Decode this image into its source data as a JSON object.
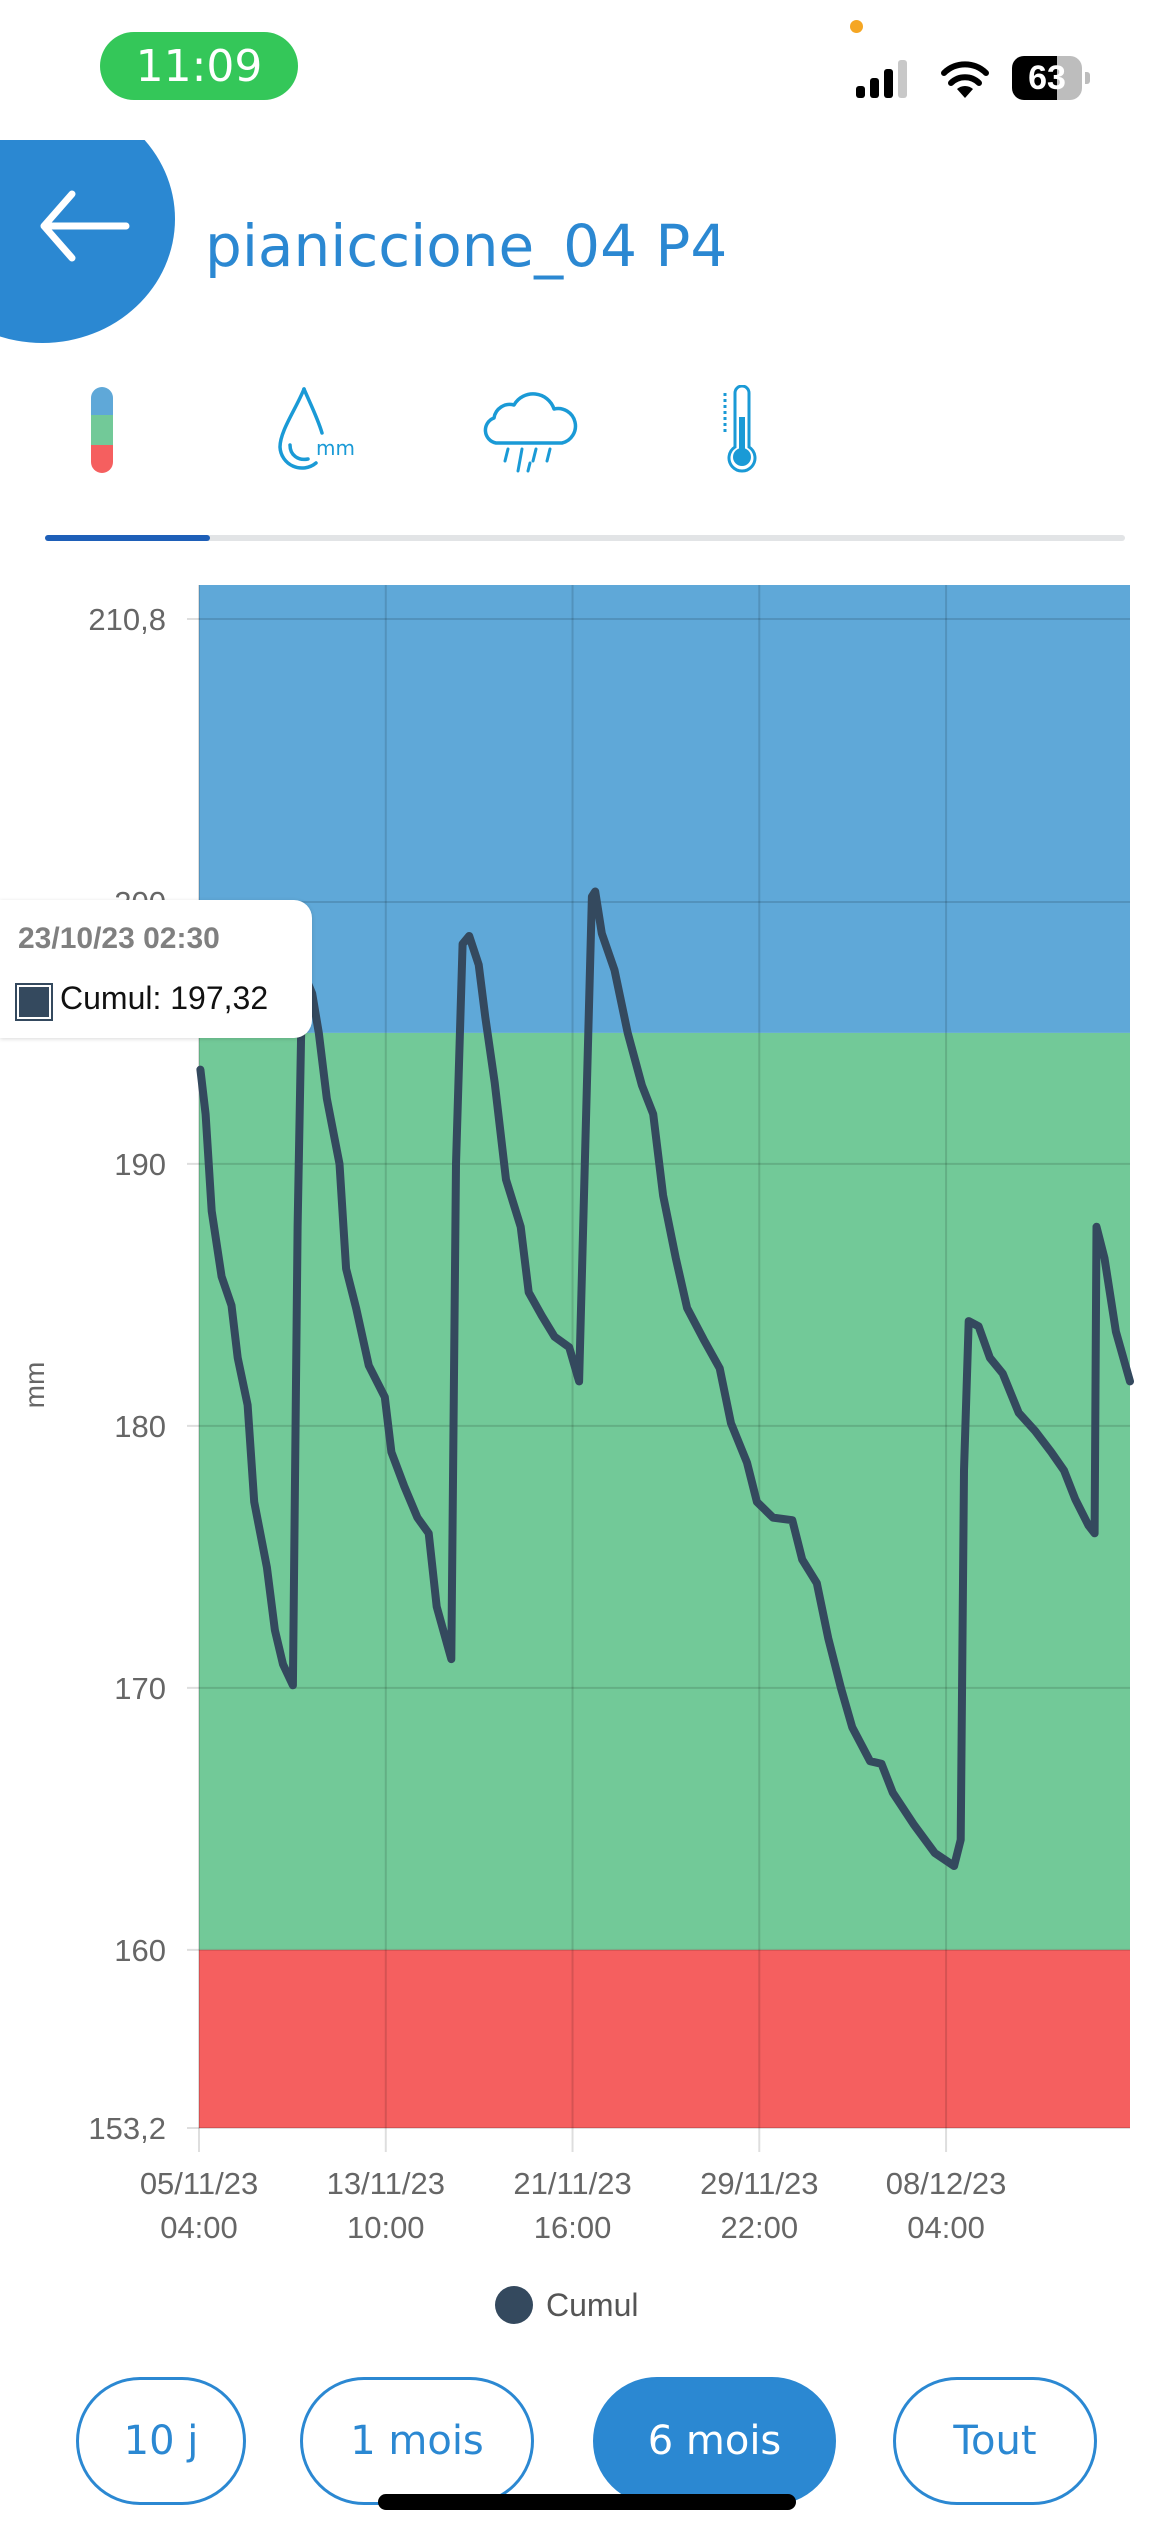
{
  "status_bar": {
    "time": "11:09",
    "battery": "63",
    "icons": [
      "cellular-signal-icon",
      "wifi-icon",
      "battery-icon"
    ]
  },
  "header": {
    "title": "pianiccione_04 P4",
    "back_icon": "arrow-left-icon"
  },
  "tabs": [
    {
      "icon": "threshold-gauge-icon",
      "active": true
    },
    {
      "icon": "water-drop-mm-icon",
      "active": false
    },
    {
      "icon": "rain-cloud-icon",
      "active": false
    },
    {
      "icon": "thermometer-icon",
      "active": false
    }
  ],
  "colors": {
    "accent": "#2b88d2",
    "band_high": "#5fa8d8",
    "band_mid": "#72c998",
    "band_low": "#f55f5f",
    "series": "#34495e"
  },
  "tooltip": {
    "date": "23/10/23 02:30",
    "text": "Cumul: 197,32"
  },
  "chart_data": {
    "type": "line",
    "title": "",
    "xlabel": "",
    "ylabel": "mm",
    "ylim": [
      153.2,
      210.8
    ],
    "xlim": [
      "2023-11-05T04:00",
      "2023-12-16T07:00"
    ],
    "y_ticks": [
      "210,8",
      "200",
      "190",
      "180",
      "170",
      "160",
      "153,2"
    ],
    "y_tick_values": [
      210.8,
      200,
      190,
      180,
      170,
      160,
      153.2
    ],
    "x_ticks": [
      {
        "value": "2023-11-05T04:00",
        "line1": "05/11/23",
        "line2": "04:00"
      },
      {
        "value": "2023-11-13T10:00",
        "line1": "13/11/23",
        "line2": "10:00"
      },
      {
        "value": "2023-11-21T16:00",
        "line1": "21/11/23",
        "line2": "16:00"
      },
      {
        "value": "2023-11-29T22:00",
        "line1": "29/11/23",
        "line2": "22:00"
      },
      {
        "value": "2023-12-08T04:00",
        "line1": "08/12/23",
        "line2": "04:00"
      }
    ],
    "grid": true,
    "bands": [
      {
        "from": 195,
        "to": 210.8,
        "color": "#5fa8d8"
      },
      {
        "from": 160,
        "to": 195,
        "color": "#72c998"
      },
      {
        "from": 153.2,
        "to": 160,
        "color": "#f55f5f"
      }
    ],
    "legend": {
      "position": "bottom",
      "entries": [
        "Cumul"
      ]
    },
    "series": [
      {
        "name": "Cumul",
        "color": "#34495e",
        "points": [
          [
            "2023-11-05T05:30",
            193.6
          ],
          [
            "2023-11-05T11:00",
            191.9
          ],
          [
            "2023-11-05T17:30",
            188.2
          ],
          [
            "2023-11-06T04:00",
            185.7
          ],
          [
            "2023-11-06T14:30",
            184.6
          ],
          [
            "2023-11-06T21:00",
            182.6
          ],
          [
            "2023-11-07T07:30",
            180.8
          ],
          [
            "2023-11-07T14:30",
            177.1
          ],
          [
            "2023-11-08T04:00",
            174.6
          ],
          [
            "2023-11-08T12:30",
            172.2
          ],
          [
            "2023-11-08T21:00",
            170.9
          ],
          [
            "2023-11-09T07:30",
            170.1
          ],
          [
            "2023-11-09T12:30",
            187.6
          ],
          [
            "2023-11-09T17:30",
            197.4
          ],
          [
            "2023-11-10T04:00",
            196.5
          ],
          [
            "2023-11-10T11:00",
            195.0
          ],
          [
            "2023-11-10T19:30",
            192.5
          ],
          [
            "2023-11-11T09:00",
            190.0
          ],
          [
            "2023-11-11T16:00",
            186.0
          ],
          [
            "2023-11-12T02:30",
            184.5
          ],
          [
            "2023-11-12T16:00",
            182.3
          ],
          [
            "2023-11-13T09:00",
            181.1
          ],
          [
            "2023-11-13T16:00",
            179.0
          ],
          [
            "2023-11-14T05:30",
            177.7
          ],
          [
            "2023-11-14T19:30",
            176.5
          ],
          [
            "2023-11-15T07:30",
            175.9
          ],
          [
            "2023-11-15T16:00",
            173.1
          ],
          [
            "2023-11-16T07:30",
            171.1
          ],
          [
            "2023-11-16T12:30",
            190.0
          ],
          [
            "2023-11-16T19:30",
            198.4
          ],
          [
            "2023-11-17T02:30",
            198.7
          ],
          [
            "2023-11-17T12:30",
            197.6
          ],
          [
            "2023-11-17T19:30",
            195.6
          ],
          [
            "2023-11-18T05:30",
            193.1
          ],
          [
            "2023-11-18T17:30",
            189.4
          ],
          [
            "2023-11-19T09:00",
            187.6
          ],
          [
            "2023-11-19T17:30",
            185.1
          ],
          [
            "2023-11-20T07:30",
            184.2
          ],
          [
            "2023-11-20T21:00",
            183.4
          ],
          [
            "2023-11-21T12:30",
            183.0
          ],
          [
            "2023-11-21T23:00",
            181.7
          ],
          [
            "2023-11-22T05:30",
            190.7
          ],
          [
            "2023-11-22T12:30",
            200.2
          ],
          [
            "2023-11-22T16:00",
            200.4
          ],
          [
            "2023-11-22T23:00",
            198.8
          ],
          [
            "2023-11-23T12:30",
            197.4
          ],
          [
            "2023-11-24T02:30",
            195.0
          ],
          [
            "2023-11-24T17:30",
            193.0
          ],
          [
            "2023-11-25T05:30",
            191.9
          ],
          [
            "2023-11-25T16:00",
            188.8
          ],
          [
            "2023-11-26T05:30",
            186.4
          ],
          [
            "2023-11-26T17:30",
            184.5
          ],
          [
            "2023-11-27T11:00",
            183.3
          ],
          [
            "2023-11-28T04:00",
            182.2
          ],
          [
            "2023-11-28T16:00",
            180.1
          ],
          [
            "2023-11-29T09:00",
            178.6
          ],
          [
            "2023-11-29T19:30",
            177.1
          ],
          [
            "2023-11-30T12:30",
            176.5
          ],
          [
            "2023-12-01T09:00",
            176.4
          ],
          [
            "2023-12-01T19:30",
            174.9
          ],
          [
            "2023-12-02T11:00",
            174.0
          ],
          [
            "2023-12-02T23:00",
            171.9
          ],
          [
            "2023-12-03T12:30",
            170.0
          ],
          [
            "2023-12-04T00:30",
            168.5
          ],
          [
            "2023-12-04T19:30",
            167.2
          ],
          [
            "2023-12-05T07:30",
            167.1
          ],
          [
            "2023-12-05T19:30",
            166.0
          ],
          [
            "2023-12-06T17:30",
            164.8
          ],
          [
            "2023-12-07T16:00",
            163.7
          ],
          [
            "2023-12-08T12:30",
            163.2
          ],
          [
            "2023-12-08T19:30",
            164.2
          ],
          [
            "2023-12-08T23:00",
            178.3
          ],
          [
            "2023-12-09T04:00",
            184.0
          ],
          [
            "2023-12-09T14:30",
            183.8
          ],
          [
            "2023-12-10T02:30",
            182.6
          ],
          [
            "2023-12-10T16:00",
            182.0
          ],
          [
            "2023-12-11T09:00",
            180.5
          ],
          [
            "2023-12-12T02:30",
            179.8
          ],
          [
            "2023-12-12T19:30",
            179.0
          ],
          [
            "2023-12-13T09:00",
            178.3
          ],
          [
            "2023-12-13T21:00",
            177.2
          ],
          [
            "2023-12-14T11:00",
            176.2
          ],
          [
            "2023-12-14T17:30",
            175.9
          ],
          [
            "2023-12-14T19:30",
            187.6
          ],
          [
            "2023-12-15T04:00",
            186.4
          ],
          [
            "2023-12-15T16:00",
            183.6
          ],
          [
            "2023-12-16T07:00",
            181.7
          ]
        ]
      }
    ]
  },
  "range_buttons": [
    {
      "label": "10 j",
      "active": false
    },
    {
      "label": "1 mois",
      "active": false
    },
    {
      "label": "6 mois",
      "active": true
    },
    {
      "label": "Tout",
      "active": false
    }
  ]
}
